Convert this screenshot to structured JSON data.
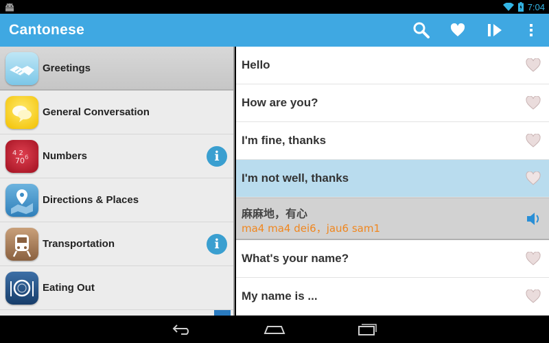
{
  "status_bar": {
    "time": "7:04"
  },
  "app": {
    "title": "Cantonese"
  },
  "action_bar": {
    "search_icon": "search-icon",
    "favorites_icon": "heart-icon",
    "play_icon": "play-icon",
    "overflow_icon": "overflow-menu-icon"
  },
  "categories": [
    {
      "label": "Greetings",
      "icon": "handshake-icon",
      "selected": true,
      "info": false
    },
    {
      "label": "General Conversation",
      "icon": "speech-bubbles-icon",
      "selected": false,
      "info": false
    },
    {
      "label": "Numbers",
      "icon": "numbers-icon",
      "selected": false,
      "info": true
    },
    {
      "label": "Directions & Places",
      "icon": "map-pin-icon",
      "selected": false,
      "info": false
    },
    {
      "label": "Transportation",
      "icon": "train-icon",
      "selected": false,
      "info": true
    },
    {
      "label": "Eating Out",
      "icon": "plate-icon",
      "selected": false,
      "info": false
    }
  ],
  "info_glyph": "i",
  "phrases": [
    {
      "text": "Hello"
    },
    {
      "text": "How are you?"
    },
    {
      "text": "I'm fine, thanks"
    },
    {
      "text": "I'm not well, thanks",
      "highlighted": true
    },
    {
      "native": "麻麻地，有心",
      "romanization": "ma4 ma4 dei6，jau6 sam1",
      "expanded": true
    },
    {
      "text": "What's your name?"
    },
    {
      "text": "My name is ..."
    }
  ],
  "colors": {
    "action_bar": "#3fa8e2",
    "highlight_row": "#b9dcee",
    "romanization": "#f0861e",
    "info_badge": "#3a9fd0"
  }
}
